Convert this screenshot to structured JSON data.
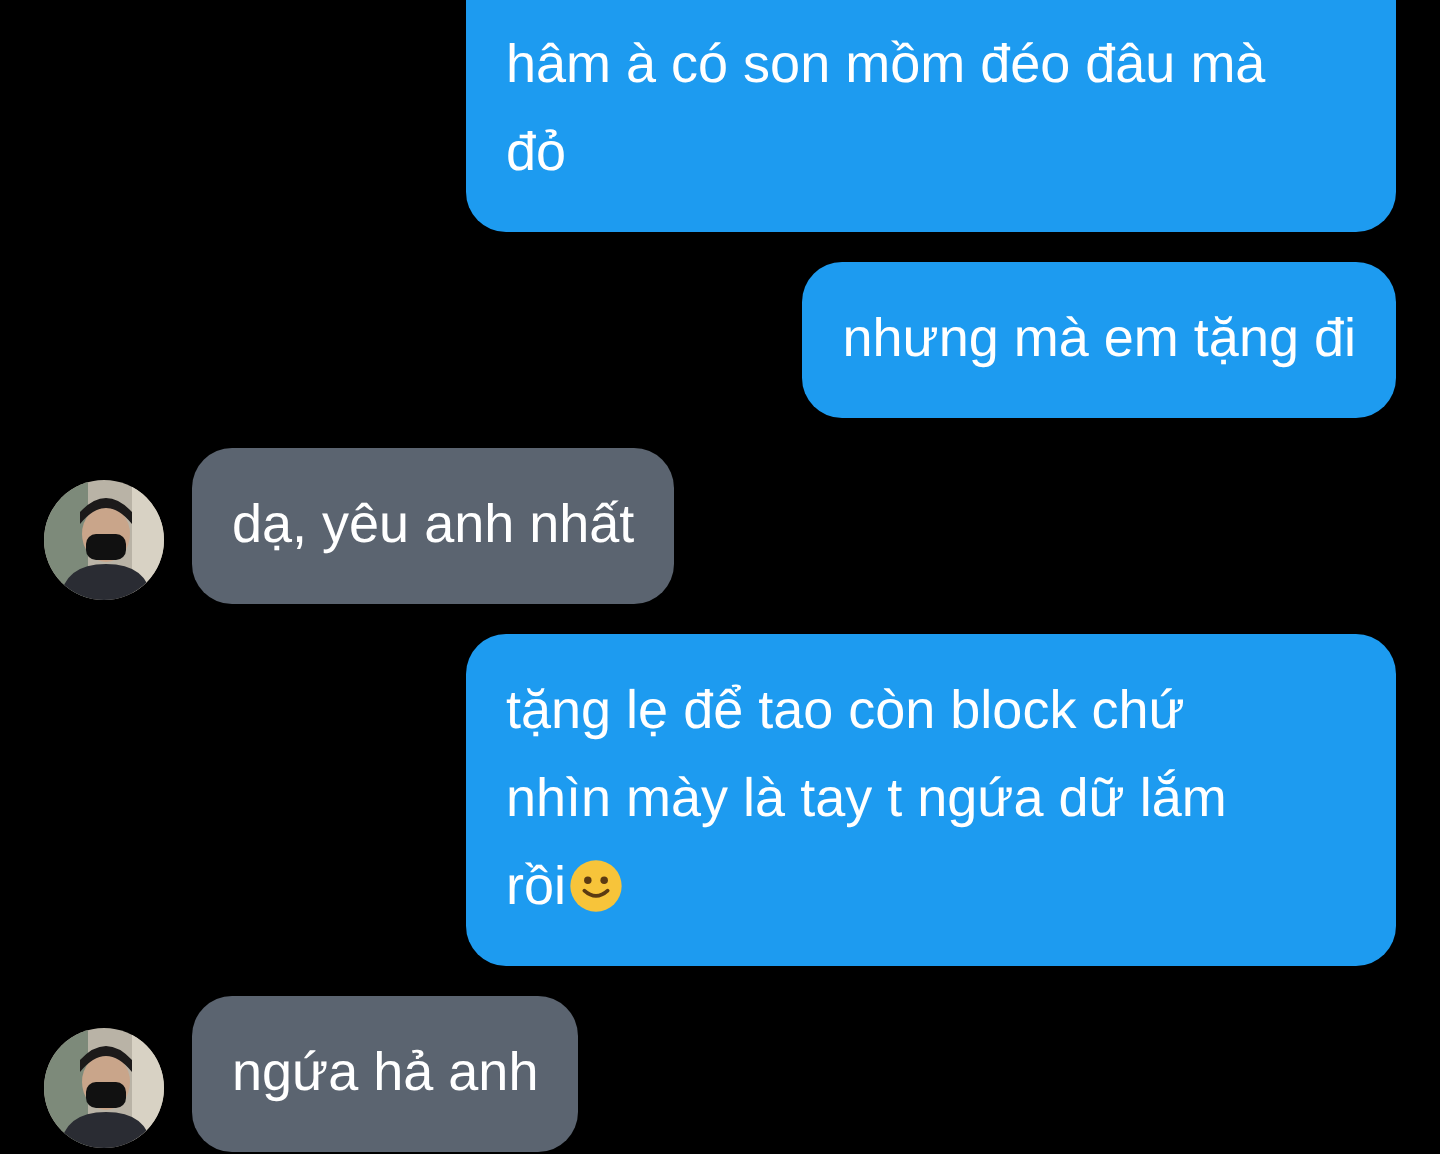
{
  "messages": [
    {
      "kind": "sent",
      "text": "hâm à có son mồm đéo đâu mà đỏ",
      "emoji": false
    },
    {
      "kind": "sent",
      "text": "nhưng mà em tặng đi",
      "emoji": false
    },
    {
      "kind": "received",
      "text": "dạ, yêu anh nhất",
      "emoji": false
    },
    {
      "kind": "sent",
      "text": "tặng lẹ để tao còn block chứ nhìn mày là tay t ngứa dữ lắm rồi",
      "emoji": true
    },
    {
      "kind": "received",
      "text": "ngứa hả anh",
      "emoji": false
    }
  ]
}
